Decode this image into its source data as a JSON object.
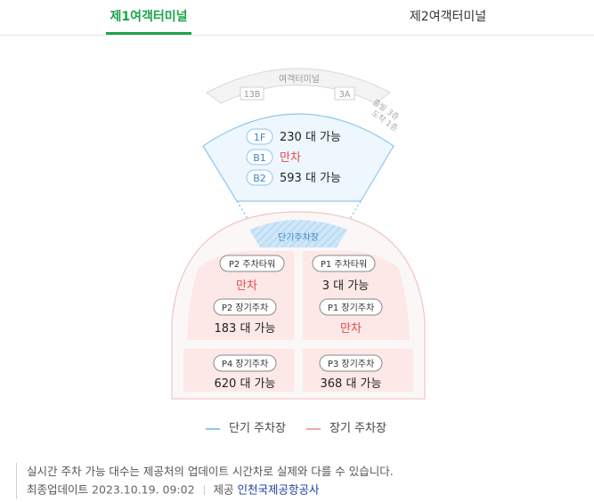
{
  "tabs": {
    "t1": "제1여객터미널",
    "t2": "제2여객터미널"
  },
  "terminal": {
    "title": "여객터미널",
    "gate_left": "13B",
    "gate_right": "3A",
    "side_note_1": "출발 3층",
    "side_note_2": "도착 1층"
  },
  "short_term": {
    "floors": [
      {
        "tag": "1F",
        "status": "230 대 가능"
      },
      {
        "tag": "B1",
        "status": "만차"
      },
      {
        "tag": "B2",
        "status": "593 대 가능"
      }
    ],
    "area_label": "단기주차장"
  },
  "long_term": {
    "p2_tower": {
      "tag": "P2 주차타워",
      "status": "만차"
    },
    "p1_tower": {
      "tag": "P1 주차타워",
      "status": "3 대 가능"
    },
    "p2_long": {
      "tag": "P2 장기주차",
      "status": "183 대 가능"
    },
    "p1_long": {
      "tag": "P1 장기주차",
      "status": "만차"
    },
    "p4_long": {
      "tag": "P4 장기주차",
      "status": "620 대 가능"
    },
    "p3_long": {
      "tag": "P3 장기주차",
      "status": "368 대 가능"
    }
  },
  "legend": {
    "short": "단기 주차장",
    "long": "장기 주차장"
  },
  "notice": {
    "line1": "실시간 주차 가능 대수는 제공처의 업데이트 시간차로 실제와 다를 수 있습니다.",
    "updated_label": "최종업데이트",
    "updated_value": "2023.10.19. 09:02",
    "provider_label": "제공",
    "provider_value": "인천국제공항공사"
  },
  "colors": {
    "accent": "#1aa44a",
    "full": "#e24a48",
    "short_blue": "#8ec7ec",
    "long_red": "#f0a8a8"
  }
}
